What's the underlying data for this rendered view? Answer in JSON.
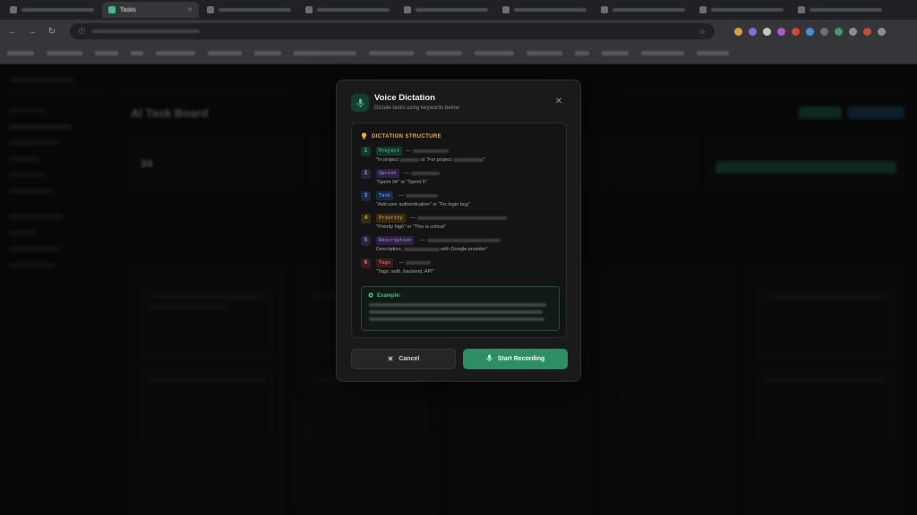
{
  "browser": {
    "active_tab_label": "Tasks",
    "tab_count": 9,
    "icons": {
      "back": "arrow-left-icon",
      "forward": "arrow-right-icon",
      "reload": "reload-icon",
      "star": "star-icon"
    }
  },
  "modal": {
    "title": "Voice Dictation",
    "subtitle": "Dictate tasks using keywords below",
    "structure_heading": "DICTATION STRUCTURE",
    "items": [
      {
        "number": "1",
        "keyword": "Project",
        "example_pre": "\"In project",
        "example_mid": "or \"For project",
        "example_post": "\"",
        "color": "#4fd18b",
        "bg": "#16382a"
      },
      {
        "number": "2",
        "keyword": "Sprint",
        "example": "\"Sprint 04\" or \"Sprint 5\"",
        "color": "#b88cf2",
        "bg": "#2c2142"
      },
      {
        "number": "3",
        "keyword": "Task",
        "example": "\"Add user authentication\" or \"Fix login bug\"",
        "color": "#63a8f5",
        "bg": "#18294a"
      },
      {
        "number": "4",
        "keyword": "Priority",
        "example": "\"Priority high\" or \"This is critical\"",
        "color": "#f0b24d",
        "bg": "#3a2c12"
      },
      {
        "number": "5",
        "keyword": "Description",
        "example_pre": "Description,",
        "example_post": "with Google provider\"",
        "color": "#b88cf2",
        "bg": "#2c2142"
      },
      {
        "number": "6",
        "keyword": "Tags",
        "example": "\"Tags: auth, backend, API\"",
        "color": "#f07a7a",
        "bg": "#3d1c1f"
      }
    ],
    "example_heading": "Example:",
    "cancel_label": "Cancel",
    "start_label": "Start Recording",
    "colors": {
      "accent_green": "#2d8d63",
      "heading_amber": "#e5b04a"
    }
  },
  "background_app": {
    "page_title": "AI Task Board",
    "stat_value": "34"
  }
}
